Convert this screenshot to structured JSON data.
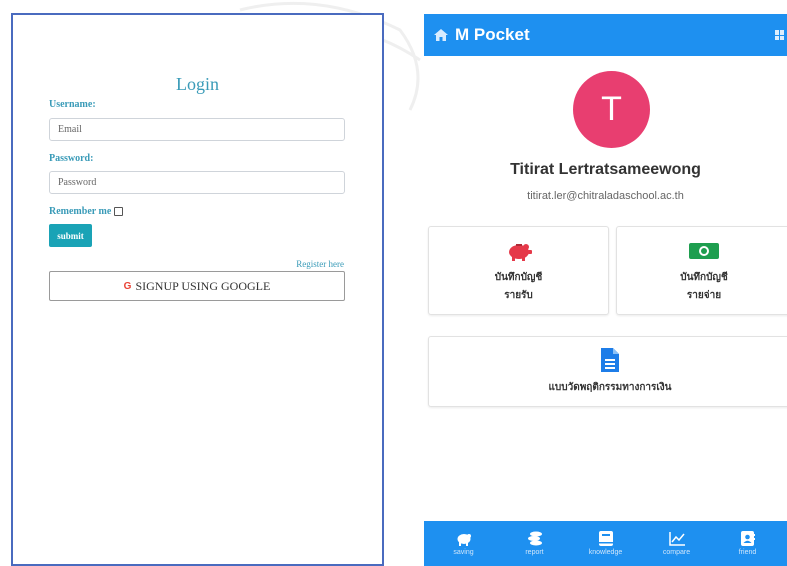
{
  "login": {
    "title": "Login",
    "username_label": "Username:",
    "username_placeholder": "Email",
    "password_label": "Password:",
    "password_placeholder": "Password",
    "remember_label": "Remember me",
    "submit_label": "submit",
    "register_link": "Register here",
    "google_label": "SIGNUP USING GOOGLE",
    "google_icon": "G"
  },
  "app": {
    "title": "M Pocket",
    "avatar_initial": "T",
    "user_name": "Titirat Lertratsameewong",
    "user_email": "titirat.ler@chitraladaschool.ac.th",
    "cards": [
      {
        "line1": "บันทึกบัญชี",
        "line2": "รายรับ",
        "icon": "piggy-bank-icon"
      },
      {
        "line1": "บันทึกบัญชี",
        "line2": "รายจ่าย",
        "icon": "money-bill-icon"
      },
      {
        "line1": "แบบวัดพฤติกรรมทางการเงิน",
        "icon": "document-icon"
      }
    ],
    "nav": [
      {
        "label": "saving",
        "icon": "piggy-bank-icon"
      },
      {
        "label": "report",
        "icon": "coins-icon"
      },
      {
        "label": "knowledge",
        "icon": "book-icon"
      },
      {
        "label": "compare",
        "icon": "chart-line-icon"
      },
      {
        "label": "friend",
        "icon": "address-book-icon"
      }
    ]
  },
  "colors": {
    "accent_blue": "#1e90f0",
    "teal": "#1aa3b6",
    "avatar_pink": "#e83e70",
    "income_red": "#e53949",
    "expense_green": "#1e9e4f"
  }
}
